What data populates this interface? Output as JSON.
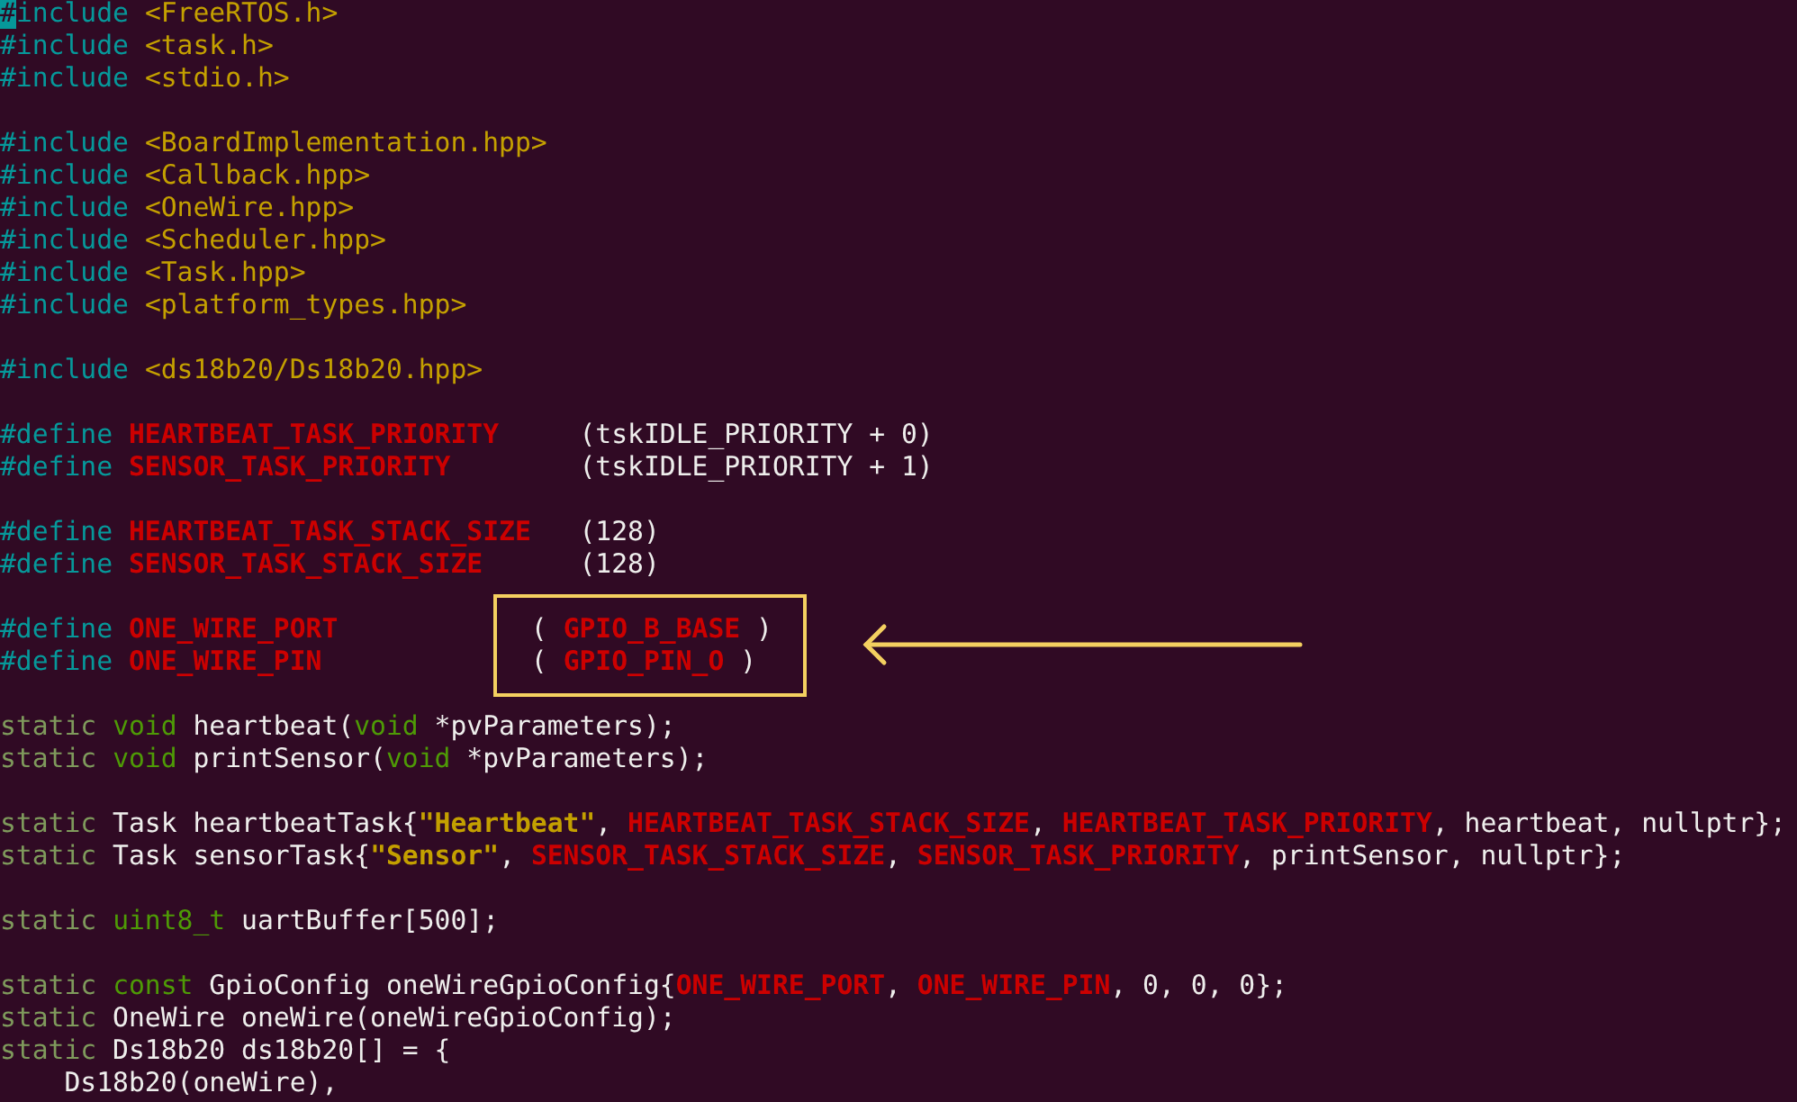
{
  "editor": {
    "blocks": [
      [
        {
          "tokens": [
            {
              "kind": "cursor",
              "text": "#"
            },
            {
              "kind": "preproc",
              "text": "include"
            },
            {
              "kind": "header",
              "text": "<FreeRTOS.h>",
              "space_before": true
            }
          ]
        },
        {
          "tokens": [
            {
              "kind": "preproc",
              "text": "#include"
            },
            {
              "kind": "header",
              "text": "<task.h>",
              "space_before": true
            }
          ]
        },
        {
          "tokens": [
            {
              "kind": "preproc",
              "text": "#include"
            },
            {
              "kind": "header",
              "text": "<stdio.h>",
              "space_before": true
            }
          ]
        }
      ],
      [
        {
          "tokens": [
            {
              "kind": "preproc",
              "text": "#include"
            },
            {
              "kind": "header",
              "text": "<BoardImplementation.hpp>",
              "space_before": true
            }
          ]
        },
        {
          "tokens": [
            {
              "kind": "preproc",
              "text": "#include"
            },
            {
              "kind": "header",
              "text": "<Callback.hpp>",
              "space_before": true
            }
          ]
        },
        {
          "tokens": [
            {
              "kind": "preproc",
              "text": "#include"
            },
            {
              "kind": "header",
              "text": "<OneWire.hpp>",
              "space_before": true
            }
          ]
        },
        {
          "tokens": [
            {
              "kind": "preproc",
              "text": "#include"
            },
            {
              "kind": "header",
              "text": "<Scheduler.hpp>",
              "space_before": true
            }
          ]
        },
        {
          "tokens": [
            {
              "kind": "preproc",
              "text": "#include"
            },
            {
              "kind": "header",
              "text": "<Task.hpp>",
              "space_before": true
            }
          ]
        },
        {
          "tokens": [
            {
              "kind": "preproc",
              "text": "#include"
            },
            {
              "kind": "header",
              "text": "<platform_types.hpp>",
              "space_before": true
            }
          ]
        }
      ],
      [
        {
          "tokens": [
            {
              "kind": "preproc",
              "text": "#include"
            },
            {
              "kind": "header",
              "text": "<ds18b20/Ds18b20.hpp>",
              "space_before": true
            }
          ]
        }
      ],
      [
        {
          "tokens": [
            {
              "kind": "preproc",
              "text": "#define"
            },
            {
              "kind": "macro",
              "text": "HEARTBEAT_TASK_PRIORITY",
              "space_before": true
            },
            {
              "kind": "plain",
              "text": "     (tskIDLE_PRIORITY + 0)"
            }
          ]
        },
        {
          "tokens": [
            {
              "kind": "preproc",
              "text": "#define"
            },
            {
              "kind": "macro",
              "text": "SENSOR_TASK_PRIORITY",
              "space_before": true
            },
            {
              "kind": "plain",
              "text": "        (tskIDLE_PRIORITY + 1)"
            }
          ]
        }
      ],
      [
        {
          "tokens": [
            {
              "kind": "preproc",
              "text": "#define"
            },
            {
              "kind": "macro",
              "text": "HEARTBEAT_TASK_STACK_SIZE",
              "space_before": true
            },
            {
              "kind": "plain",
              "text": "   (128)"
            }
          ]
        },
        {
          "tokens": [
            {
              "kind": "preproc",
              "text": "#define"
            },
            {
              "kind": "macro",
              "text": "SENSOR_TASK_STACK_SIZE",
              "space_before": true
            },
            {
              "kind": "plain",
              "text": "      (128)"
            }
          ]
        }
      ],
      [
        {
          "tokens": [
            {
              "kind": "preproc",
              "text": "#define"
            },
            {
              "kind": "macro",
              "text": "ONE_WIRE_PORT",
              "space_before": true
            },
            {
              "kind": "plain",
              "text": "            ( "
            },
            {
              "kind": "macro",
              "text": "GPIO_B_BASE"
            },
            {
              "kind": "plain",
              "text": " )"
            }
          ]
        },
        {
          "tokens": [
            {
              "kind": "preproc",
              "text": "#define"
            },
            {
              "kind": "macro",
              "text": "ONE_WIRE_PIN",
              "space_before": true
            },
            {
              "kind": "plain",
              "text": "             ( "
            },
            {
              "kind": "macro",
              "text": "GPIO_PIN_O"
            },
            {
              "kind": "plain",
              "text": " )"
            }
          ]
        }
      ],
      [
        {
          "tokens": [
            {
              "kind": "storage",
              "text": "static"
            },
            {
              "kind": "type",
              "text": "void",
              "space_before": true
            },
            {
              "kind": "plain",
              "text": " heartbeat("
            },
            {
              "kind": "type",
              "text": "void"
            },
            {
              "kind": "plain",
              "text": " *pvParameters);"
            }
          ]
        },
        {
          "tokens": [
            {
              "kind": "storage",
              "text": "static"
            },
            {
              "kind": "type",
              "text": "void",
              "space_before": true
            },
            {
              "kind": "plain",
              "text": " printSensor("
            },
            {
              "kind": "type",
              "text": "void"
            },
            {
              "kind": "plain",
              "text": " *pvParameters);"
            }
          ]
        }
      ],
      [
        {
          "tokens": [
            {
              "kind": "storage",
              "text": "static"
            },
            {
              "kind": "plain",
              "text": " Task heartbeatTask{"
            },
            {
              "kind": "string",
              "text": "\"Heartbeat\""
            },
            {
              "kind": "plain",
              "text": ", "
            },
            {
              "kind": "macro",
              "text": "HEARTBEAT_TASK_STACK_SIZE"
            },
            {
              "kind": "plain",
              "text": ", "
            },
            {
              "kind": "macro",
              "text": "HEARTBEAT_TASK_PRIORITY"
            },
            {
              "kind": "plain",
              "text": ", heartbeat, nullptr};"
            }
          ]
        },
        {
          "tokens": [
            {
              "kind": "storage",
              "text": "static"
            },
            {
              "kind": "plain",
              "text": " Task sensorTask{"
            },
            {
              "kind": "string",
              "text": "\"Sensor\""
            },
            {
              "kind": "plain",
              "text": ", "
            },
            {
              "kind": "macro",
              "text": "SENSOR_TASK_STACK_SIZE"
            },
            {
              "kind": "plain",
              "text": ", "
            },
            {
              "kind": "macro",
              "text": "SENSOR_TASK_PRIORITY"
            },
            {
              "kind": "plain",
              "text": ", printSensor, nullptr};"
            }
          ]
        }
      ],
      [
        {
          "tokens": [
            {
              "kind": "storage",
              "text": "static"
            },
            {
              "kind": "type",
              "text": "uint8_t",
              "space_before": true
            },
            {
              "kind": "plain",
              "text": " uartBuffer[500];"
            }
          ]
        }
      ],
      [
        {
          "tokens": [
            {
              "kind": "storage",
              "text": "static"
            },
            {
              "kind": "type",
              "text": "const",
              "space_before": true
            },
            {
              "kind": "plain",
              "text": " GpioConfig oneWireGpioConfig{"
            },
            {
              "kind": "macro",
              "text": "ONE_WIRE_PORT"
            },
            {
              "kind": "plain",
              "text": ", "
            },
            {
              "kind": "macro",
              "text": "ONE_WIRE_PIN"
            },
            {
              "kind": "plain",
              "text": ", 0, 0, 0};"
            }
          ]
        },
        {
          "tokens": [
            {
              "kind": "storage",
              "text": "static"
            },
            {
              "kind": "plain",
              "text": " OneWire oneWire(oneWireGpioConfig);"
            }
          ]
        },
        {
          "tokens": [
            {
              "kind": "storage",
              "text": "static"
            },
            {
              "kind": "plain",
              "text": " Ds18b20 ds18b20[] = {"
            }
          ]
        },
        {
          "tokens": [
            {
              "kind": "plain",
              "text": "    Ds18b20(oneWire),"
            }
          ]
        }
      ]
    ]
  }
}
